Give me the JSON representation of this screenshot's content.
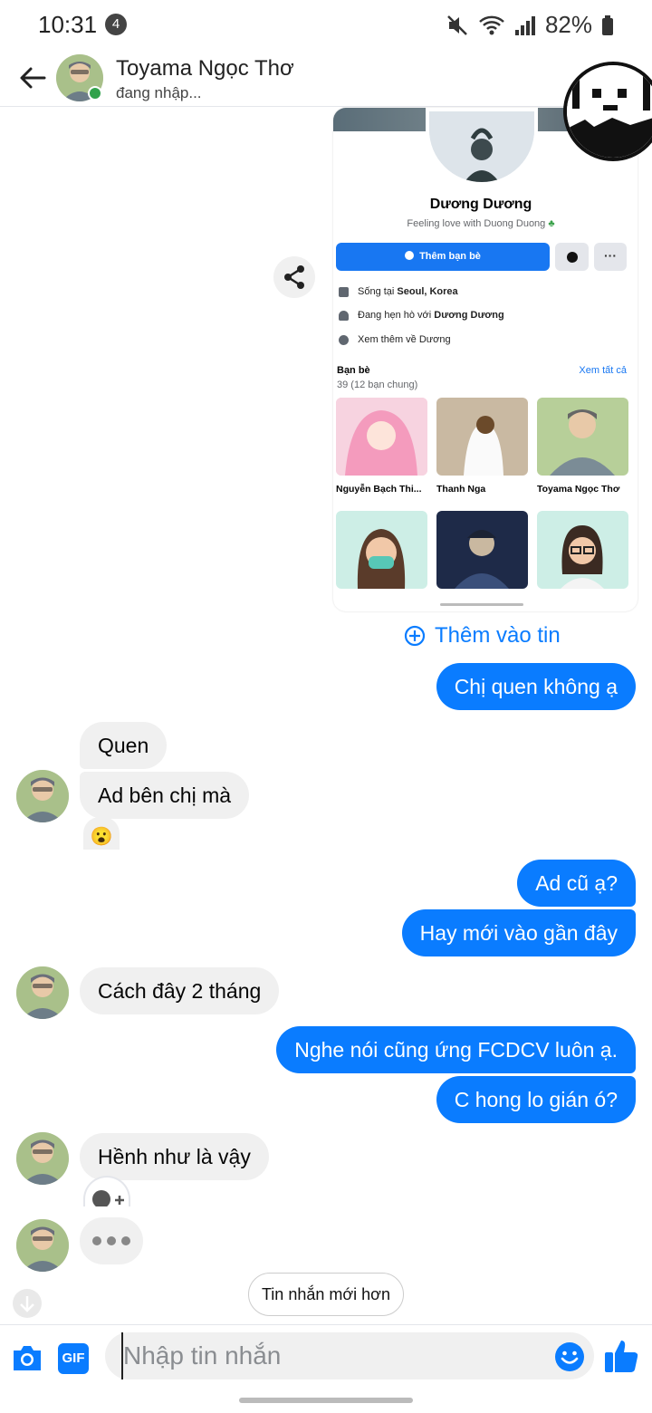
{
  "status_bar": {
    "time": "10:31",
    "notification_count": "4",
    "battery": "82%",
    "icons": [
      "mute-icon",
      "wifi-icon",
      "signal-icon",
      "battery-icon"
    ]
  },
  "header": {
    "contact_name": "Toyama Ngọc Thơ",
    "status": "đang nhập...",
    "online": true
  },
  "shared_image": {
    "profile_name": "Dương Dương",
    "bio": "Feeling love with Duong Duong",
    "add_friend_label": "Thêm bạn bè",
    "info": [
      {
        "prefix": "Sống tại ",
        "bold": "Seoul, Korea"
      },
      {
        "prefix": "Đang hẹn hò với ",
        "bold": "Dương Dương"
      },
      {
        "prefix": "Xem thêm về Dương",
        "bold": ""
      }
    ],
    "friends_title": "Bạn bè",
    "friends_count": "39 (12 bạn chung)",
    "see_all": "Xem tất cả",
    "friends": [
      {
        "name": "Nguyễn Bạch Thi..."
      },
      {
        "name": "Thanh Nga"
      },
      {
        "name": "Toyama Ngọc Thơ"
      }
    ]
  },
  "add_to_story": "Thêm vào tin",
  "messages": {
    "m1": "Chị quen không ạ",
    "m2": "Quen",
    "m3": "Ad bên chị mà",
    "m4": "Ad cũ ạ?",
    "m5": "Hay mới vào gần đây",
    "m6": "Cách đây 2 tháng",
    "m7": "Nghe nói cũng ứng FCDCV luôn ạ.",
    "m8": "C hong lo gián ó?",
    "m9": "Hềnh như là vậy"
  },
  "reaction_emoji": "😮",
  "newer_messages_label": "Tin nhắn mới hơn",
  "composer": {
    "placeholder": "Nhập tin nhắn",
    "gif_label": "GIF"
  },
  "colors": {
    "accent": "#0a7cff",
    "incoming_bubble": "#f0f0f0",
    "online": "#31a24c"
  }
}
